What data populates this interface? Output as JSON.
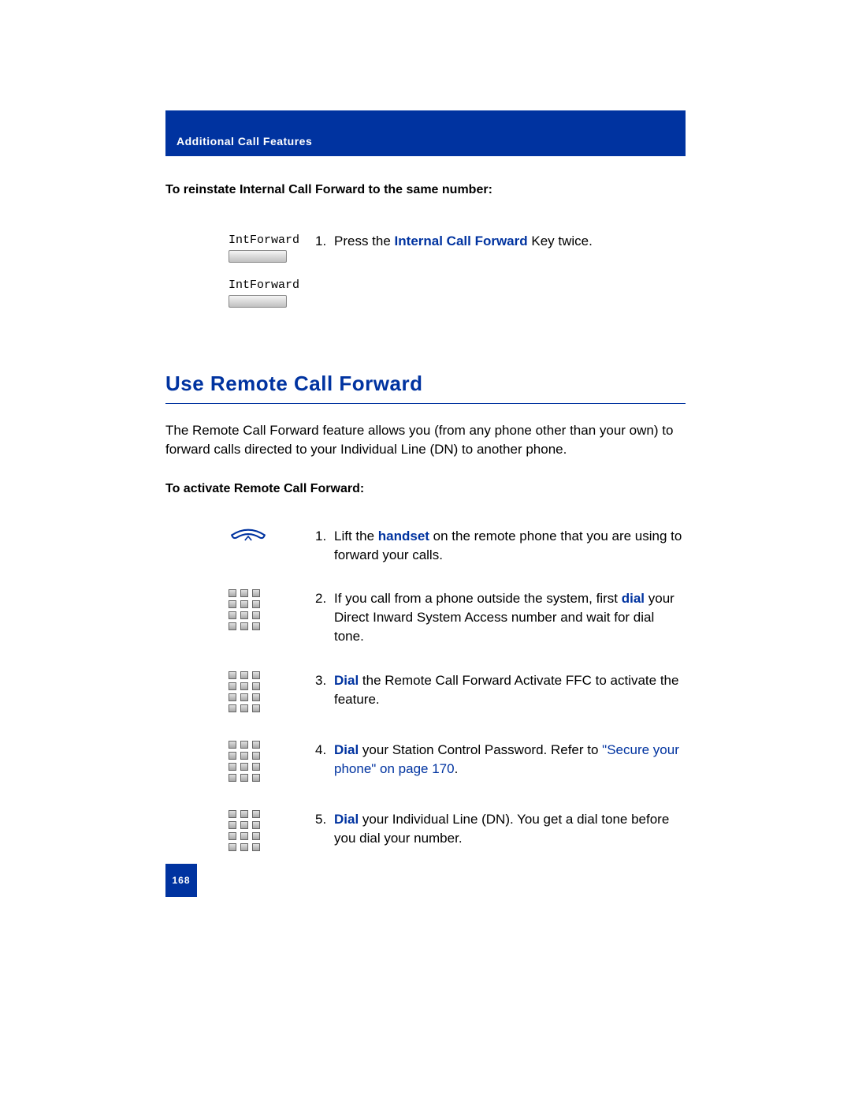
{
  "header": {
    "title": "Additional Call Features"
  },
  "section1": {
    "title": "To reinstate Internal Call Forward to the same number:",
    "key_label": "IntForward",
    "step1_num": "1.",
    "step1_pre": "Press the ",
    "step1_bold": "Internal Call Forward",
    "step1_post": " Key twice."
  },
  "h2": "Use Remote Call Forward",
  "intro": "The Remote Call Forward feature allows you (from any phone other than your own) to forward calls directed to your Individual Line (DN) to another phone.",
  "section2": {
    "title": "To activate Remote Call Forward:",
    "s1": {
      "num": "1.",
      "pre": "Lift the ",
      "bold": "handset",
      "post": " on the remote phone that you are using to forward your calls."
    },
    "s2": {
      "num": "2.",
      "pre": "If you call from a phone outside the system, first ",
      "bold": "dial",
      "post": " your Direct Inward System Access number and wait for dial tone."
    },
    "s3": {
      "num": "3.",
      "bold": "Dial",
      "post": " the Remote Call Forward Activate FFC to activate the feature."
    },
    "s4": {
      "num": "4.",
      "bold": "Dial",
      "post": " your Station Control Password. Refer to ",
      "link": "\"Secure your phone\" on page 170",
      "after": "."
    },
    "s5": {
      "num": "5.",
      "bold": "Dial",
      "post": " your Individual Line (DN). You get a dial tone before you dial your number."
    }
  },
  "page_number": "168"
}
